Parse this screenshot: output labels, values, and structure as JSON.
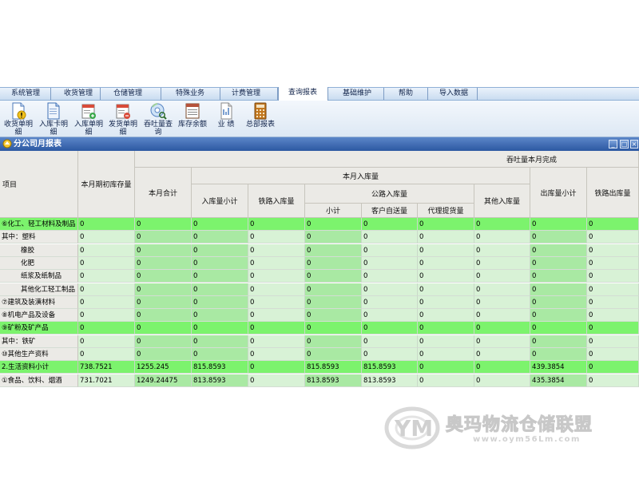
{
  "menu": {
    "tabs": [
      {
        "label": "系统管理"
      },
      {
        "label": "收货管理"
      },
      {
        "label": "仓储管理"
      },
      {
        "label": "特殊业务"
      },
      {
        "label": "计费管理"
      },
      {
        "label": "查询报表",
        "active": true
      },
      {
        "label": "基础维护"
      },
      {
        "label": "帮助"
      },
      {
        "label": "导入数据"
      }
    ]
  },
  "toolbar": {
    "buttons": [
      {
        "line1": "收货单明",
        "line2": "细",
        "icon": "document-warning-icon"
      },
      {
        "line1": "入库卡明",
        "line2": "细",
        "icon": "document-icon"
      },
      {
        "line1": "入库单明",
        "line2": "细",
        "icon": "document-add-icon"
      },
      {
        "line1": "发货单明",
        "line2": "细",
        "icon": "document-remove-icon"
      },
      {
        "line1": "吞吐量查",
        "line2": "询",
        "icon": "disc-search-icon"
      },
      {
        "line1": "库存余额",
        "line2": "",
        "icon": "ledger-icon"
      },
      {
        "line1": "业  绩",
        "line2": "",
        "icon": "report-icon"
      },
      {
        "line1": "总部报表",
        "line2": "",
        "icon": "calculator-icon"
      }
    ]
  },
  "window": {
    "title": "分公司月报表",
    "controls": {
      "minimize": "_",
      "maximize": "□",
      "close": "×"
    }
  },
  "report": {
    "headers": {
      "item": "项目",
      "opening_stock": "本月期初库存量",
      "throughput_group": "吞吐量本月完成",
      "month_total": "本月合计",
      "inbound_group": "本月入库量",
      "inbound_subtotal": "入库量小计",
      "rail_inbound": "铁路入库量",
      "road_inbound_group": "公路入库量",
      "road_subtotal": "小计",
      "customer_delivery": "客户自送量",
      "agent_pickup": "代理提货量",
      "other_inbound": "其他入库量",
      "outbound_subtotal": "出库量小计",
      "rail_outbound": "铁路出库量"
    },
    "rows": [
      {
        "name": "⑥化工、轻工材料及制品",
        "indent": 0,
        "highlight": true,
        "values": [
          "0",
          "0",
          "0",
          "0",
          "0",
          "0",
          "0",
          "0",
          "0",
          "0"
        ]
      },
      {
        "name": "其中：塑料",
        "indent": 0,
        "highlight": false,
        "values": [
          "0",
          "0",
          "0",
          "0",
          "0",
          "0",
          "0",
          "0",
          "0",
          "0"
        ]
      },
      {
        "name": "橡胶",
        "indent": 1,
        "highlight": false,
        "values": [
          "0",
          "0",
          "0",
          "0",
          "0",
          "0",
          "0",
          "0",
          "0",
          "0"
        ]
      },
      {
        "name": "化肥",
        "indent": 1,
        "highlight": false,
        "values": [
          "0",
          "0",
          "0",
          "0",
          "0",
          "0",
          "0",
          "0",
          "0",
          "0"
        ]
      },
      {
        "name": "纸浆及纸制品",
        "indent": 1,
        "highlight": false,
        "values": [
          "0",
          "0",
          "0",
          "0",
          "0",
          "0",
          "0",
          "0",
          "0",
          "0"
        ]
      },
      {
        "name": "其他化工轻工制品",
        "indent": 1,
        "highlight": false,
        "values": [
          "0",
          "0",
          "0",
          "0",
          "0",
          "0",
          "0",
          "0",
          "0",
          "0"
        ]
      },
      {
        "name": "⑦建筑及装潢材料",
        "indent": 0,
        "highlight": false,
        "values": [
          "0",
          "0",
          "0",
          "0",
          "0",
          "0",
          "0",
          "0",
          "0",
          "0"
        ]
      },
      {
        "name": "⑧机电产品及设备",
        "indent": 0,
        "highlight": false,
        "values": [
          "0",
          "0",
          "0",
          "0",
          "0",
          "0",
          "0",
          "0",
          "0",
          "0"
        ]
      },
      {
        "name": "⑨矿粉及矿产品",
        "indent": 0,
        "highlight": true,
        "values": [
          "0",
          "0",
          "0",
          "0",
          "0",
          "0",
          "0",
          "0",
          "0",
          "0"
        ]
      },
      {
        "name": "其中：铁矿",
        "indent": 0,
        "highlight": false,
        "values": [
          "0",
          "0",
          "0",
          "0",
          "0",
          "0",
          "0",
          "0",
          "0",
          "0"
        ]
      },
      {
        "name": "⑩其他生产资料",
        "indent": 0,
        "highlight": false,
        "values": [
          "0",
          "0",
          "0",
          "0",
          "0",
          "0",
          "0",
          "0",
          "0",
          "0"
        ]
      },
      {
        "name": "2.生活资料小计",
        "indent": 0,
        "highlight": true,
        "values": [
          "738.7521",
          "1255.245",
          "815.8593",
          "0",
          "815.8593",
          "815.8593",
          "0",
          "0",
          "439.3854",
          "0"
        ]
      },
      {
        "name": "①食品、饮料、烟酒",
        "indent": 0,
        "highlight": false,
        "values": [
          "731.7021",
          "1249.24475",
          "813.8593",
          "0",
          "813.8593",
          "813.8593",
          "0",
          "0",
          "435.3854",
          "0"
        ]
      }
    ]
  },
  "watermark": {
    "brand": "奥玛物流仓储联盟",
    "url": "www.oym56Lm.com",
    "logo_letters": "YM"
  }
}
